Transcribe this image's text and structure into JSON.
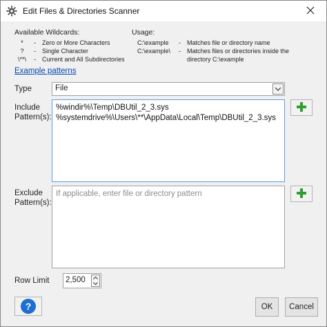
{
  "window": {
    "title": "Edit Files & Directories Scanner",
    "icon": "gear-icon",
    "close_label": "✕"
  },
  "wildcards": {
    "title": "Available Wildcards:",
    "items": [
      {
        "symbol": "*",
        "desc": "Zero or More Characters"
      },
      {
        "symbol": "?",
        "desc": "Single Character"
      },
      {
        "symbol": "\\**\\",
        "desc": "Current and All Subdirectories"
      }
    ]
  },
  "usage": {
    "title": "Usage:",
    "items": [
      {
        "path": "C:\\example",
        "desc": "Matches file or directory name"
      },
      {
        "path": "C:\\example\\",
        "desc": "Matches files or directories inside the"
      },
      {
        "path": "",
        "desc": "directory C:\\example"
      }
    ]
  },
  "example_link": "Example patterns",
  "type": {
    "label": "Type",
    "value": "File"
  },
  "include": {
    "label_line1": "Include",
    "label_line2": "Pattern(s):",
    "lines": [
      "%windir%\\Temp\\DBUtil_2_3.sys",
      "%systemdrive%\\Users\\**\\AppData\\Local\\Temp\\DBUtil_2_3.sys"
    ]
  },
  "exclude": {
    "label_line1": "Exclude",
    "label_line2": "Pattern(s):",
    "placeholder": "If applicable, enter file or directory pattern"
  },
  "row_limit": {
    "label": "Row Limit",
    "value": "2,500"
  },
  "buttons": {
    "help": "?",
    "ok": "OK",
    "cancel": "Cancel"
  },
  "colors": {
    "accent": "#1d6fd1",
    "add_plus": "#2e9e2e",
    "link": "#0645ad"
  }
}
